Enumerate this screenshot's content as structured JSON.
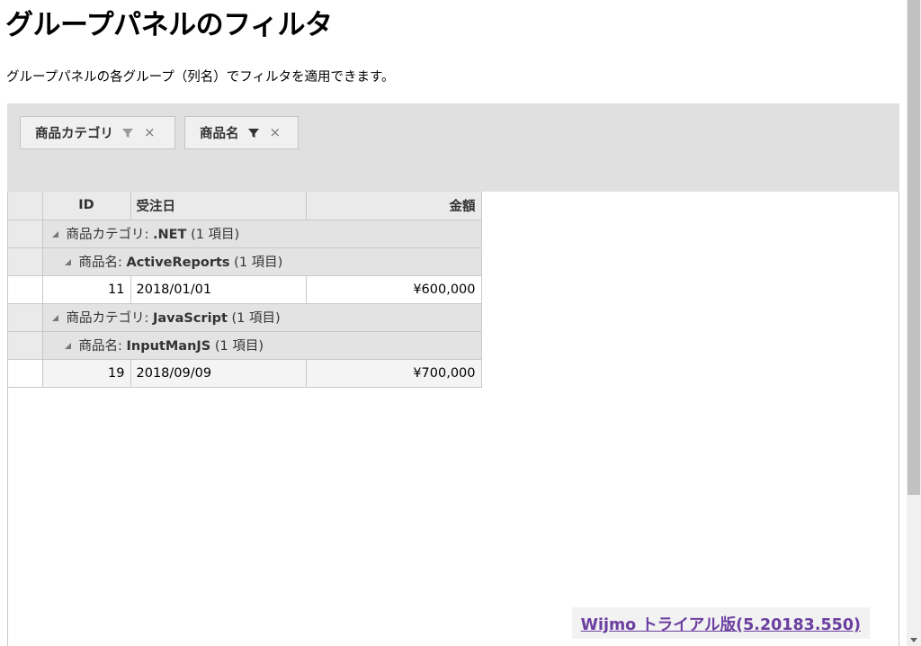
{
  "page": {
    "title": "グループパネルのフィルタ",
    "description": "グループパネルの各グループ（列名）でフィルタを適用できます。"
  },
  "group_panel": {
    "chips": [
      {
        "label": "商品カテゴリ",
        "icon": "filter-icon",
        "filter_active": false,
        "close": "×"
      },
      {
        "label": "商品名",
        "icon": "filter-icon",
        "filter_active": true,
        "close": "×"
      }
    ]
  },
  "grid": {
    "columns": [
      "ID",
      "受注日",
      "金額"
    ],
    "groups": [
      {
        "field": "商品カテゴリ:",
        "value": ".NET",
        "count": "(1 項目)",
        "subgroup": {
          "field": "商品名:",
          "value": "ActiveReports",
          "count": "(1 項目)"
        },
        "row": {
          "id": "11",
          "date": "2018/01/01",
          "amount": "¥600,000"
        }
      },
      {
        "field": "商品カテゴリ:",
        "value": "JavaScript",
        "count": "(1 項目)",
        "subgroup": {
          "field": "商品名:",
          "value": "InputManJS",
          "count": "(1 項目)"
        },
        "row": {
          "id": "19",
          "date": "2018/09/09",
          "amount": "¥700,000"
        }
      }
    ]
  },
  "watermark": {
    "text": "Wijmo トライアル版(5.20183.550)"
  },
  "colors": {
    "group_panel_bg": "#e0e0e0",
    "link": "#6b3fa0",
    "active_filter": "#333333",
    "inactive_filter": "#999999"
  }
}
